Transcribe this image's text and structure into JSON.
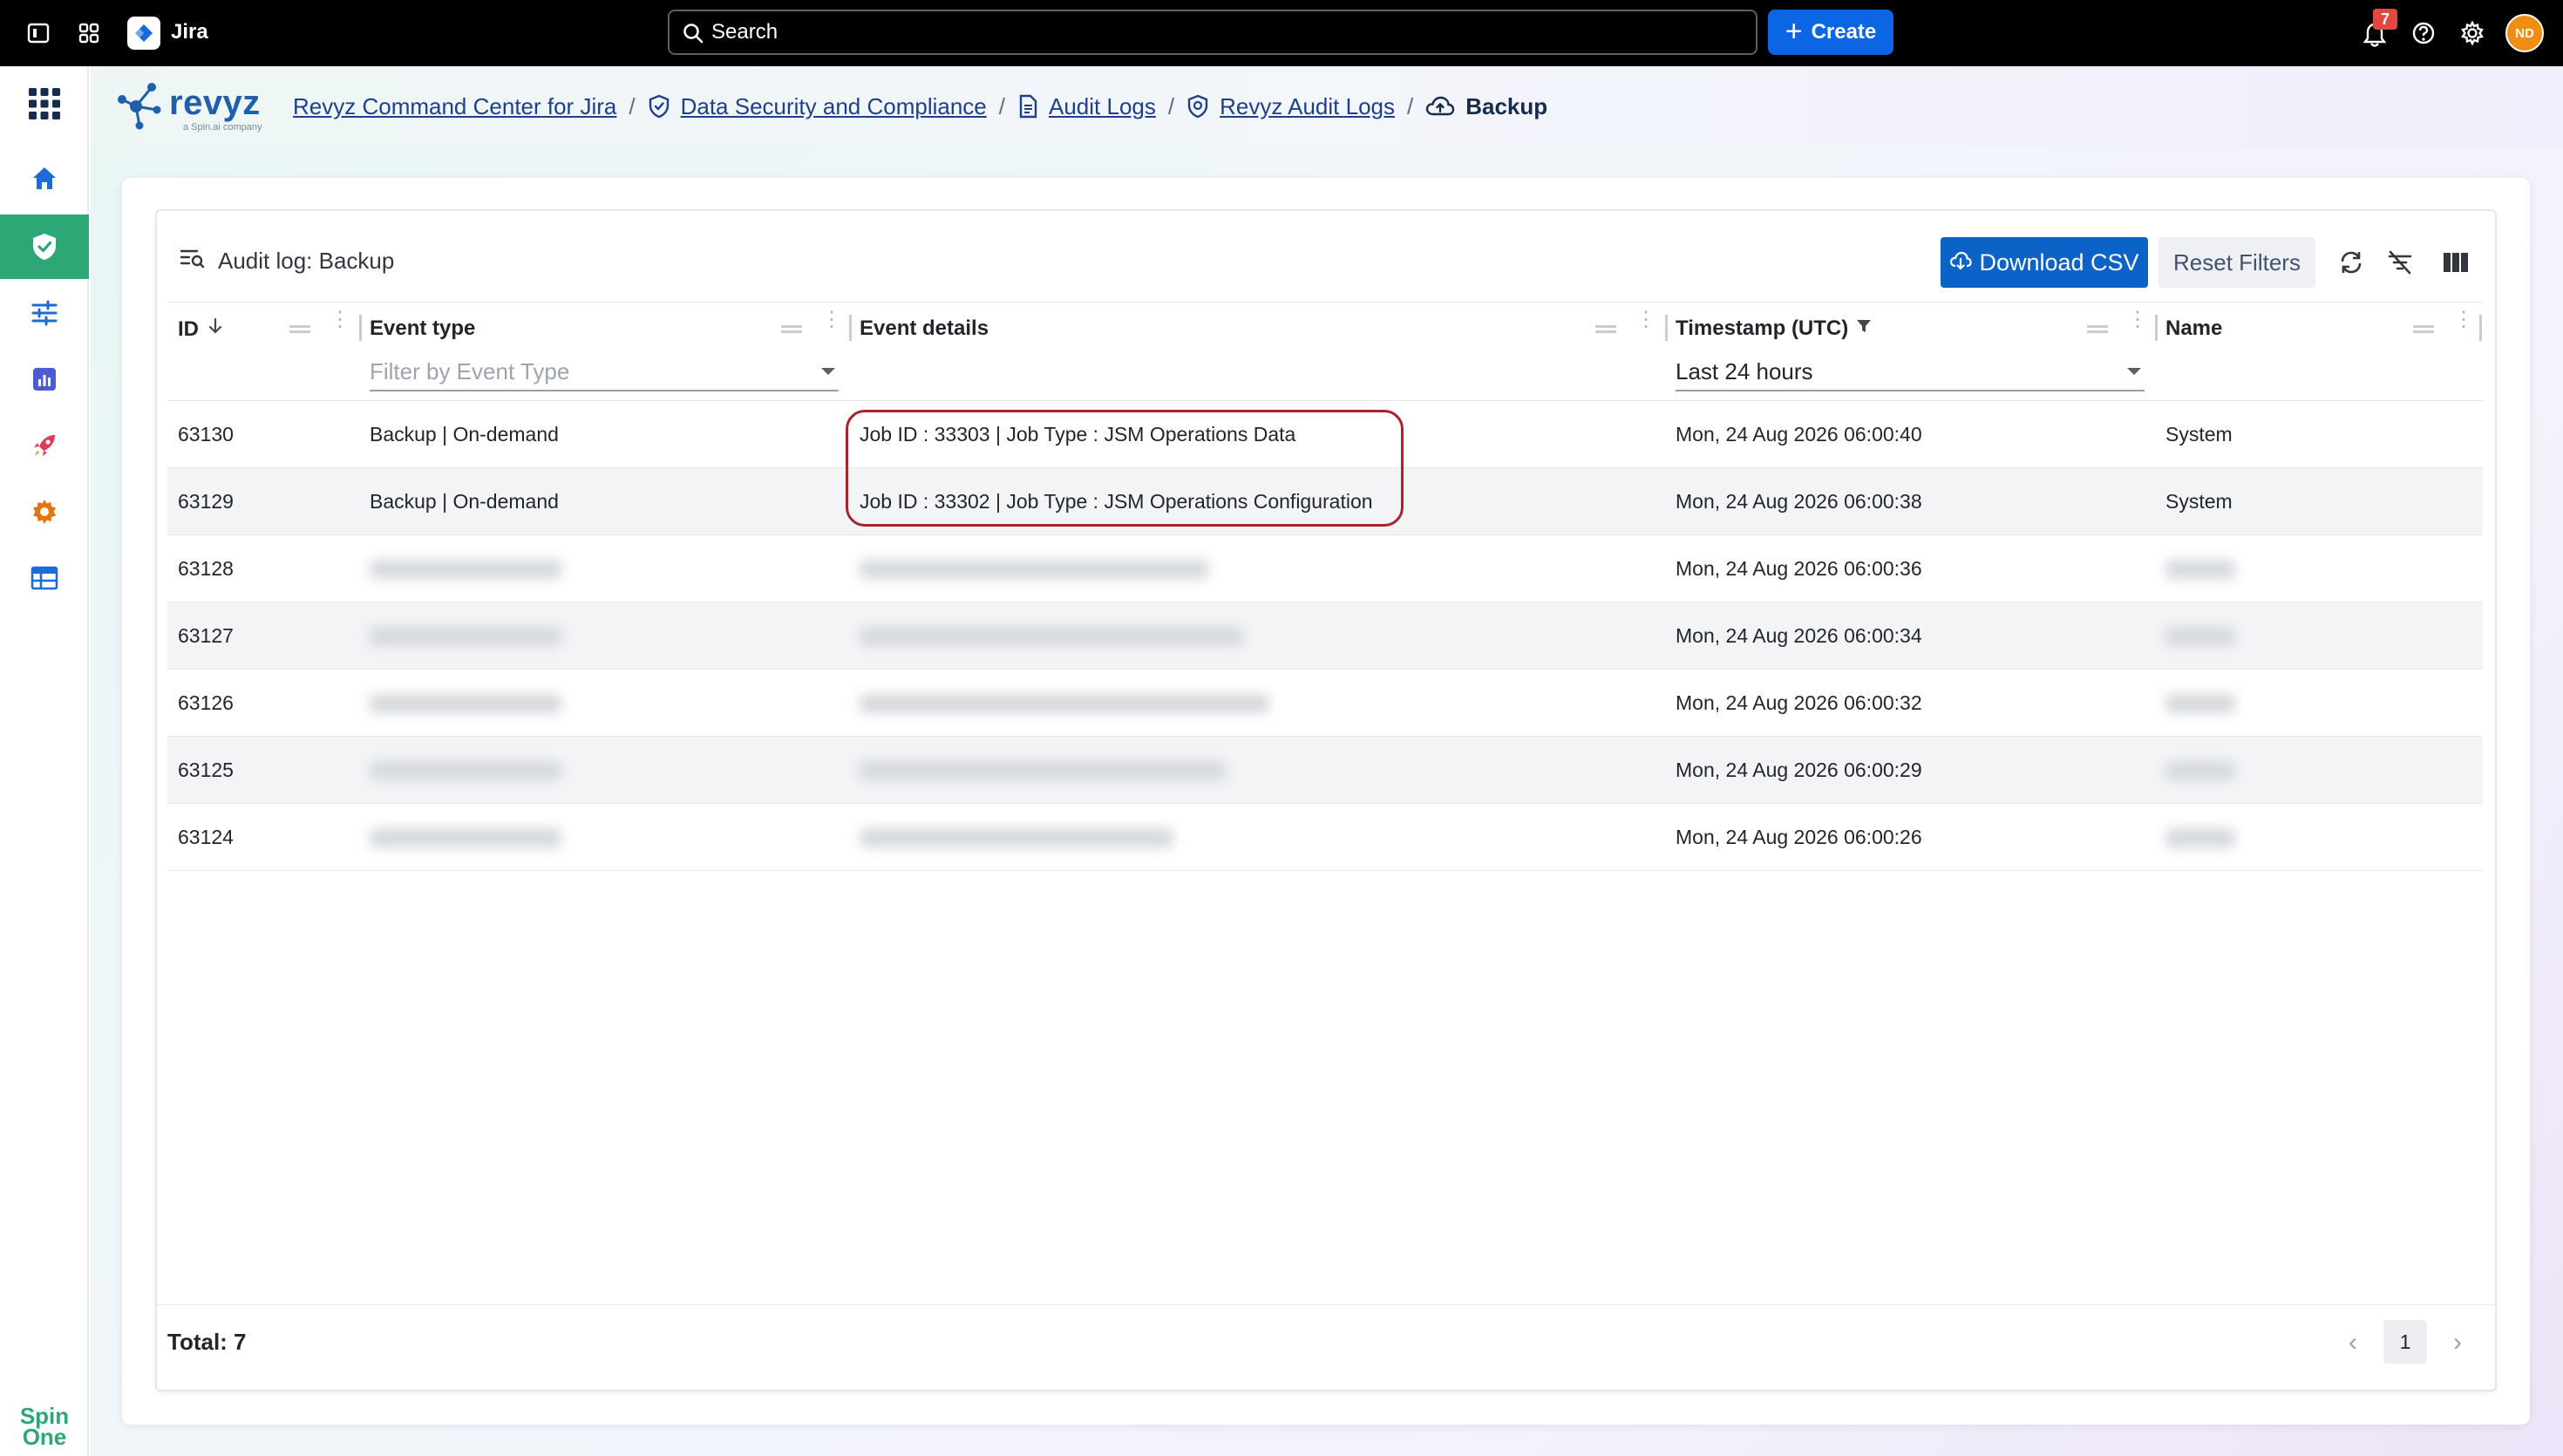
{
  "topbar": {
    "app_name": "Jira",
    "search_placeholder": "Search",
    "create_label": "Create",
    "notification_count": "7",
    "avatar_initials": "ND"
  },
  "sidebar": {
    "items": [
      {
        "icon": "home-icon"
      },
      {
        "icon": "shield-check-icon",
        "active": true
      },
      {
        "icon": "sliders-icon"
      },
      {
        "icon": "report-chart-icon"
      },
      {
        "icon": "rocket-icon"
      },
      {
        "icon": "gear-icon"
      },
      {
        "icon": "table-icon"
      }
    ],
    "footer_logo_line1": "Spin",
    "footer_logo_line2": "One"
  },
  "brand": {
    "name": "revyz",
    "tagline": "a Spin.ai company"
  },
  "breadcrumb": [
    {
      "label": "Revyz Command Center for Jira",
      "icon": null
    },
    {
      "label": "Data Security and Compliance",
      "icon": "shield-icon"
    },
    {
      "label": "Audit Logs",
      "icon": "document-icon"
    },
    {
      "label": "Revyz Audit Logs",
      "icon": "shield-badge-icon"
    },
    {
      "label": "Backup",
      "icon": "cloud-upload-icon",
      "current": true
    }
  ],
  "card": {
    "title": "Audit log: Backup",
    "download_label": "Download CSV",
    "reset_label": "Reset Filters"
  },
  "table": {
    "columns": [
      {
        "label": "ID"
      },
      {
        "label": "Event type",
        "filter_placeholder": "Filter by Event Type"
      },
      {
        "label": "Event details"
      },
      {
        "label": "Timestamp (UTC)",
        "filter_value": "Last 24 hours"
      },
      {
        "label": "Name"
      }
    ],
    "rows": [
      {
        "id": "63130",
        "event_type": "Backup | On-demand",
        "details": "Job ID : 33303 | Job Type : JSM Operations Data",
        "timestamp": "Mon, 24 Aug 2026 06:00:40",
        "name": "System"
      },
      {
        "id": "63129",
        "event_type": "Backup | On-demand",
        "details": "Job ID : 33302 | Job Type : JSM Operations Configuration",
        "timestamp": "Mon, 24 Aug 2026 06:00:38",
        "name": "System"
      },
      {
        "id": "63128",
        "timestamp": "Mon, 24 Aug 2026 06:00:36",
        "redacted": true
      },
      {
        "id": "63127",
        "timestamp": "Mon, 24 Aug 2026 06:00:34",
        "redacted": true
      },
      {
        "id": "63126",
        "timestamp": "Mon, 24 Aug 2026 06:00:32",
        "redacted": true
      },
      {
        "id": "63125",
        "timestamp": "Mon, 24 Aug 2026 06:00:29",
        "redacted": true
      },
      {
        "id": "63124",
        "timestamp": "Mon, 24 Aug 2026 06:00:26",
        "redacted": true
      }
    ]
  },
  "footer": {
    "total_label": "Total: 7",
    "current_page": "1"
  },
  "colors": {
    "topbar": "#000000",
    "create_button": "#0c66e4",
    "sidebar_active": "#2ea777",
    "download_button": "#0b63c7",
    "highlight_outline": "#a8232c"
  }
}
